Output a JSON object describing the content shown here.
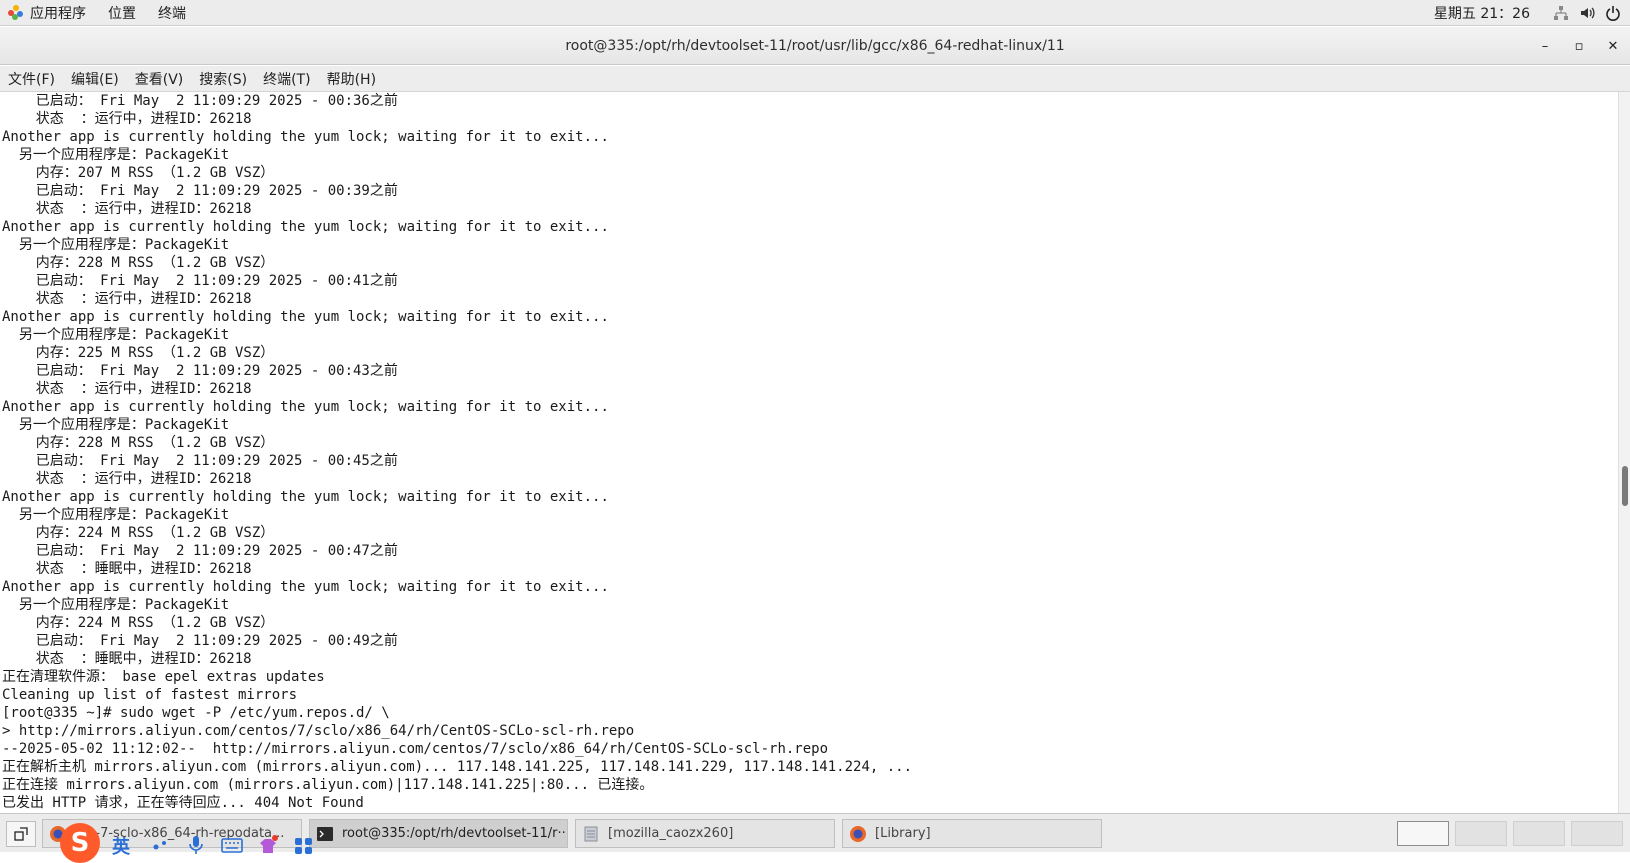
{
  "top_panel": {
    "menu": [
      "应用程序",
      "位置",
      "终端"
    ],
    "clock": "星期五 21：26",
    "tray_icons": [
      "network-icon",
      "volume-icon",
      "power-icon"
    ]
  },
  "window": {
    "title": "root@335:/opt/rh/devtoolset-11/root/usr/lib/gcc/x86_64-redhat-linux/11",
    "controls": {
      "minimize": "–",
      "maximize": "▫",
      "close": "✕"
    }
  },
  "menubar": [
    "文件(F)",
    "编辑(E)",
    "查看(V)",
    "搜索(S)",
    "终端(T)",
    "帮助(H)"
  ],
  "terminal": {
    "lines": [
      "    已启动： Fri May  2 11:09:29 2025 - 00:36之前",
      "    状态  ：运行中，进程ID：26218",
      "Another app is currently holding the yum lock; waiting for it to exit...",
      "  另一个应用程序是：PackageKit",
      "    内存：207 M RSS （1.2 GB VSZ）",
      "    已启动： Fri May  2 11:09:29 2025 - 00:39之前",
      "    状态  ：运行中，进程ID：26218",
      "Another app is currently holding the yum lock; waiting for it to exit...",
      "  另一个应用程序是：PackageKit",
      "    内存：228 M RSS （1.2 GB VSZ）",
      "    已启动： Fri May  2 11:09:29 2025 - 00:41之前",
      "    状态  ：运行中，进程ID：26218",
      "Another app is currently holding the yum lock; waiting for it to exit...",
      "  另一个应用程序是：PackageKit",
      "    内存：225 M RSS （1.2 GB VSZ）",
      "    已启动： Fri May  2 11:09:29 2025 - 00:43之前",
      "    状态  ：运行中，进程ID：26218",
      "Another app is currently holding the yum lock; waiting for it to exit...",
      "  另一个应用程序是：PackageKit",
      "    内存：228 M RSS （1.2 GB VSZ）",
      "    已启动： Fri May  2 11:09:29 2025 - 00:45之前",
      "    状态  ：运行中，进程ID：26218",
      "Another app is currently holding the yum lock; waiting for it to exit...",
      "  另一个应用程序是：PackageKit",
      "    内存：224 M RSS （1.2 GB VSZ）",
      "    已启动： Fri May  2 11:09:29 2025 - 00:47之前",
      "    状态  ：睡眠中，进程ID：26218",
      "Another app is currently holding the yum lock; waiting for it to exit...",
      "  另一个应用程序是：PackageKit",
      "    内存：224 M RSS （1.2 GB VSZ）",
      "    已启动： Fri May  2 11:09:29 2025 - 00:49之前",
      "    状态  ：睡眠中，进程ID：26218",
      "正在清理软件源： base epel extras updates",
      "Cleaning up list of fastest mirrors",
      "[root@335 ~]# sudo wget -P /etc/yum.repos.d/ \\",
      "> http://mirrors.aliyun.com/centos/7/sclo/x86_64/rh/CentOS-SCLo-scl-rh.repo",
      "--2025-05-02 11:12:02--  http://mirrors.aliyun.com/centos/7/sclo/x86_64/rh/CentOS-SCLo-scl-rh.repo",
      "正在解析主机 mirrors.aliyun.com (mirrors.aliyun.com)... 117.148.141.225, 117.148.141.229, 117.148.141.224, ...",
      "正在连接 mirrors.aliyun.com (mirrors.aliyun.com)|117.148.141.225|:80... 已连接。",
      "已发出 HTTP 请求，正在等待回应... 404 Not Found"
    ]
  },
  "taskbar": {
    "tasks": [
      {
        "label": "...e-7-sclo-x86_64-rh-repodata...",
        "icon": "firefox-icon",
        "active": false
      },
      {
        "label": "root@335:/opt/rh/devtoolset-11/r···",
        "icon": "terminal-icon",
        "active": true
      },
      {
        "label": "[mozilla_caozx260]",
        "icon": "file-manager-icon",
        "active": false
      },
      {
        "label": "[Library]",
        "icon": "firefox-icon",
        "active": false
      }
    ],
    "workspaces": [
      true,
      false,
      false,
      false
    ]
  },
  "ime": {
    "logo_text": "S",
    "mode_label": "英"
  }
}
